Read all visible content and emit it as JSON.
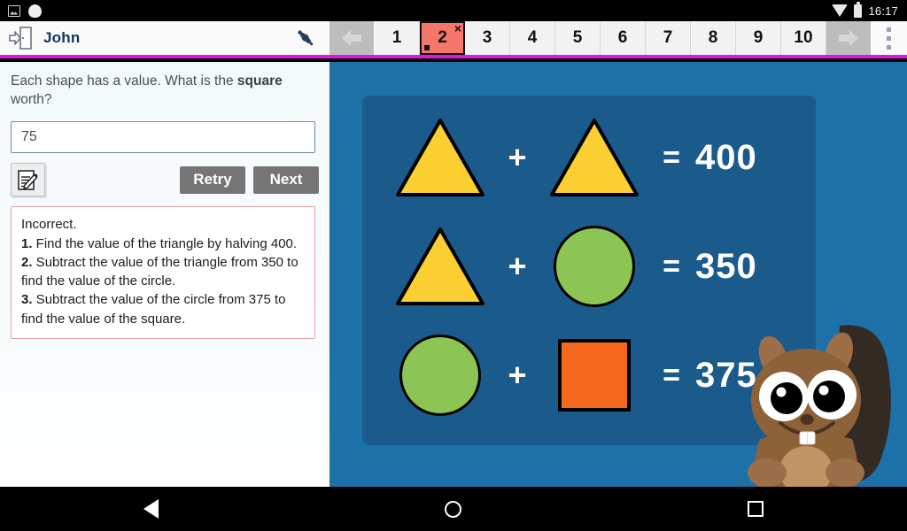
{
  "statusbar": {
    "clock": "16:17",
    "icons": [
      "screenshot-icon",
      "blob-icon",
      "wifi-icon",
      "battery-icon"
    ]
  },
  "appbar": {
    "exit_icon": "exit-door-icon",
    "user_name": "John",
    "pen_icon": "pen-icon",
    "prev_label": "◀",
    "next_label": "▶",
    "kebab_icon": "more-options-icon",
    "tabs": [
      {
        "label": "1",
        "active": false
      },
      {
        "label": "2",
        "active": true
      },
      {
        "label": "3",
        "active": false
      },
      {
        "label": "4",
        "active": false
      },
      {
        "label": "5",
        "active": false
      },
      {
        "label": "6",
        "active": false
      },
      {
        "label": "7",
        "active": false
      },
      {
        "label": "8",
        "active": false
      },
      {
        "label": "9",
        "active": false
      },
      {
        "label": "10",
        "active": false
      }
    ],
    "active_tab_close": "×",
    "accent_color": "#e314e3",
    "active_tab_color": "#f5776c"
  },
  "left_panel": {
    "question_part1": "Each shape has a value. What is the ",
    "question_bold": "square",
    "question_part2": " worth?",
    "answer_value": "75",
    "answer_placeholder": "",
    "edit_icon": "edit-note-icon",
    "retry_label": "Retry",
    "next_label": "Next",
    "feedback": {
      "line0": "Incorrect.",
      "line1_num": "1.",
      "line1_text": " Find the value of the triangle by halving 400.",
      "line2_num": "2.",
      "line2_text": " Subtract the value of the triangle from 350 to find the value of the circle.",
      "line3_num": "3.",
      "line3_text": " Subtract the value of the circle from 375 to find the value of the square.",
      "border_color": "#e6a2a2"
    }
  },
  "right_panel": {
    "background_color": "#1c72a8",
    "card_color": "#1b5b8c",
    "mascot": "squirrel-mascot",
    "shape_colors": {
      "triangle": "#fbcf31",
      "circle": "#8cc553",
      "square": "#f4671c"
    },
    "equations": [
      {
        "left_shape": "triangle",
        "operator": "+",
        "right_shape": "triangle",
        "equals": "=",
        "value": "400"
      },
      {
        "left_shape": "triangle",
        "operator": "+",
        "right_shape": "circle",
        "equals": "=",
        "value": "350"
      },
      {
        "left_shape": "circle",
        "operator": "+",
        "right_shape": "square",
        "equals": "=",
        "value": "375"
      }
    ]
  },
  "navbar": {
    "back_icon": "nav-back-icon",
    "home_icon": "nav-home-icon",
    "recents_icon": "nav-recents-icon"
  }
}
